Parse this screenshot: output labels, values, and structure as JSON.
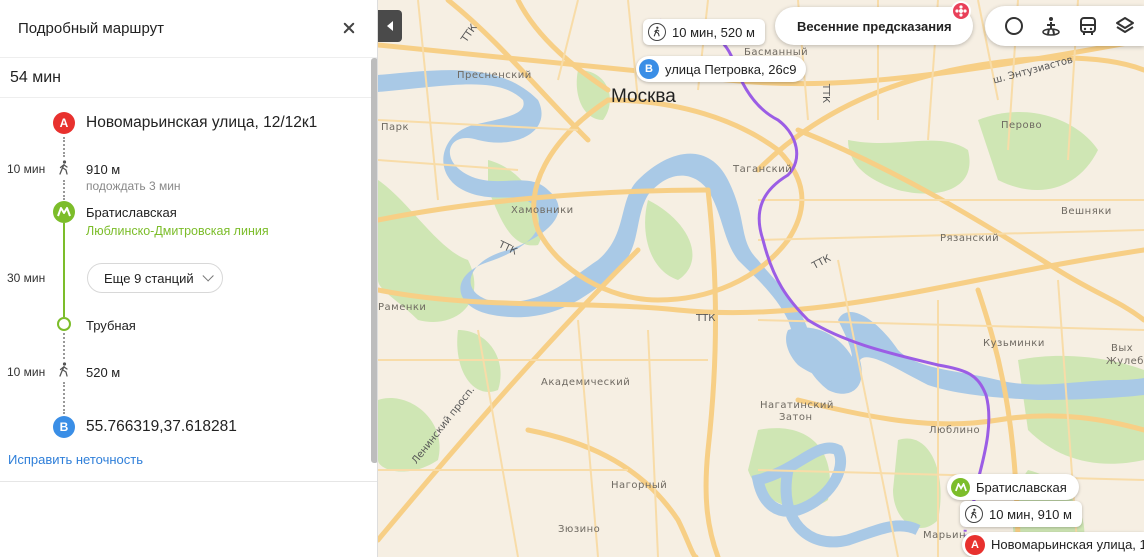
{
  "panel": {
    "title": "Подробный маршрут",
    "duration": "54 мин",
    "start": {
      "marker": "A",
      "address": "Новомарьинская улица, 12/12к1"
    },
    "walk1": {
      "time": "10 мин",
      "distance": "910 м",
      "note": "подождать 3 мин"
    },
    "board": {
      "station": "Братиславская",
      "line": "Люблинско-Дмитровская линия"
    },
    "ride": {
      "time": "30 мин",
      "more_stations": "Еще 9 станций"
    },
    "alight": {
      "station": "Трубная"
    },
    "walk2": {
      "time": "10 мин",
      "distance": "520 м"
    },
    "end": {
      "marker": "B",
      "coords": "55.766319,37.618281"
    },
    "report_link": "Исправить неточность"
  },
  "map": {
    "city": "Москва",
    "spring_button": "Весенние предсказания",
    "top_walk_pill": "10 мин, 520 м",
    "end_pill": {
      "marker": "B",
      "text": "улица Петровка, 26с9"
    },
    "station_pill": "Братиславская",
    "bottom_walk_pill": "10 мин, 910 м",
    "start_pill": {
      "marker": "A",
      "text": "Новомарьинская улица, 1"
    },
    "districts": {
      "presnensky": "Пресненский",
      "basmanny": "Басманный",
      "park": "Парк",
      "perovo": "Перово",
      "tagansky": "Таганский",
      "khamovniki": "Хамовники",
      "veshnyaki": "Вешняки",
      "ryazansky": "Рязанский",
      "ramenki": "Раменки",
      "kuzminki": "Кузьминки",
      "vykh": "Вых",
      "zhuleb": "Жулеб",
      "akademichesky": "Академический",
      "nagatinsky_1": "Нагатинский",
      "nagatinsky_2": "Затон",
      "lyublino": "Люблино",
      "nagorny": "Нагорный",
      "zyuzino": "Зюзино",
      "maryino": "Марьин"
    },
    "roads": {
      "ttk": "ТТК",
      "entuziastov": "ш. Энтузиастов",
      "leninsky": "Ленинский просп."
    },
    "route_color": "#9b5de5",
    "metro_line_color": "#7cbd2a",
    "icons": [
      "close-icon",
      "walk-icon",
      "metro-icon",
      "collapse-arrow-icon",
      "traffic-icon",
      "panorama-icon",
      "transport-icon",
      "layers-icon",
      "flower-icon"
    ]
  }
}
